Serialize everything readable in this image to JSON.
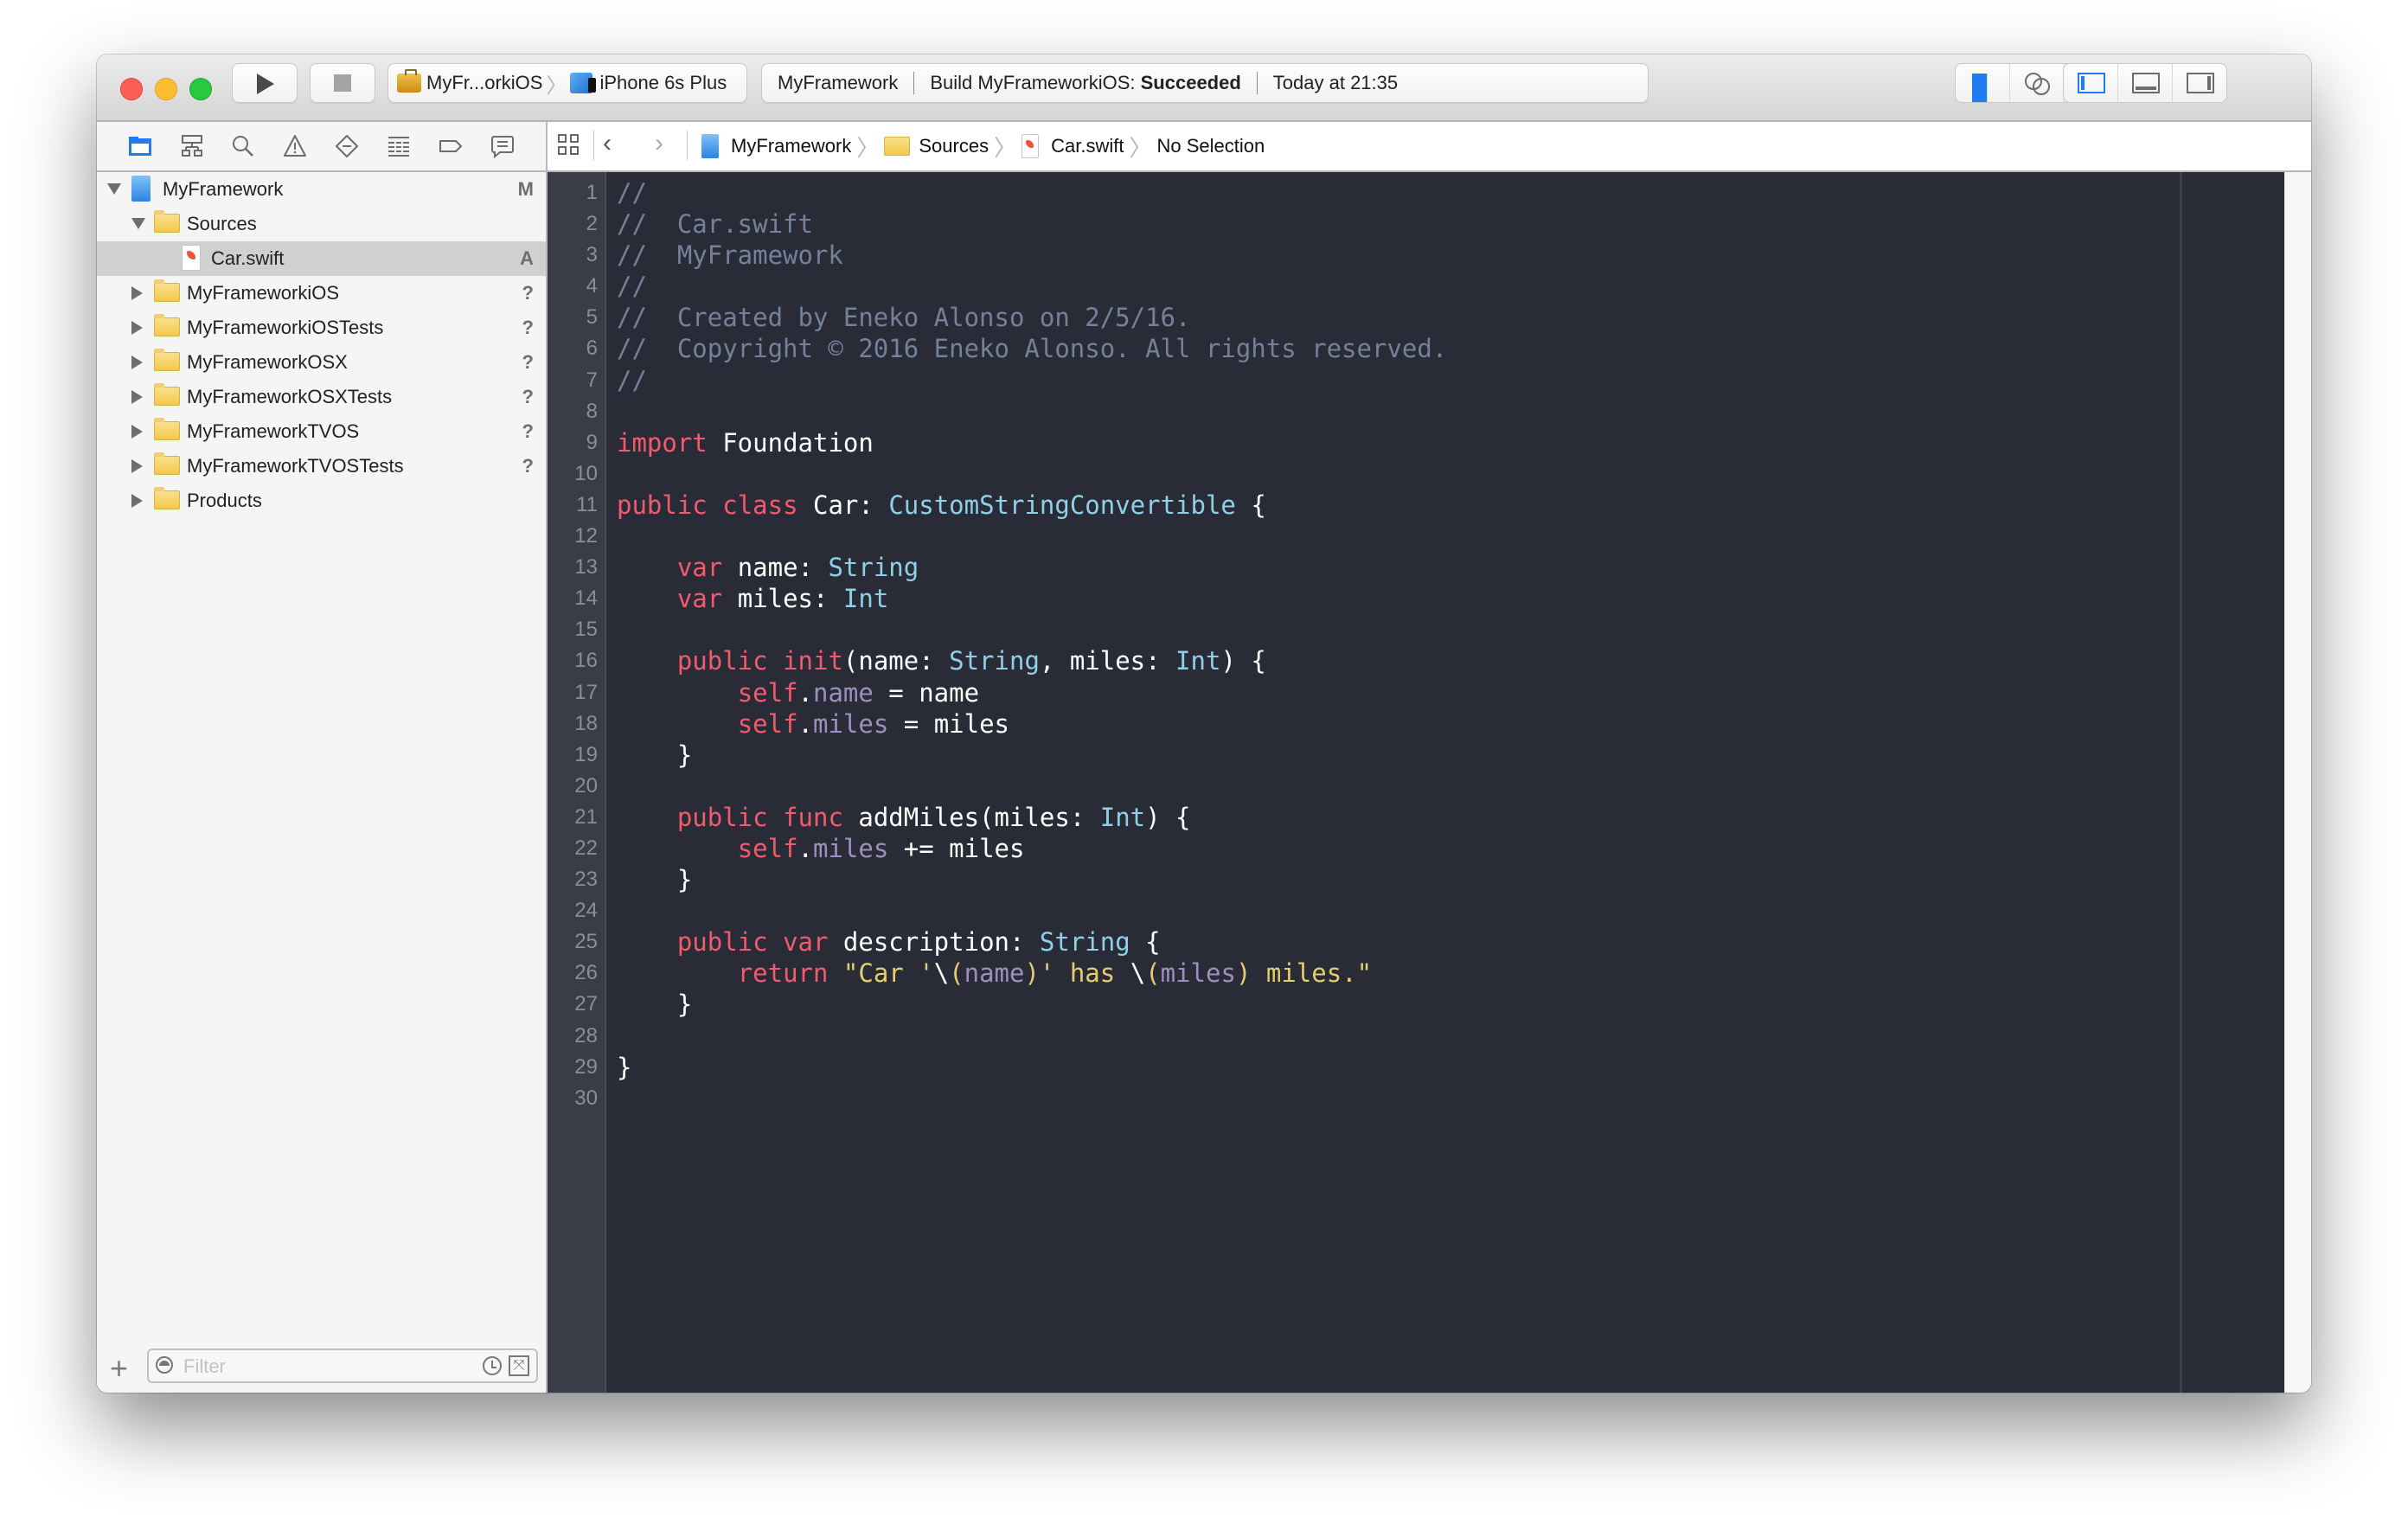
{
  "window": {
    "toolbar": {
      "run_button": "Run",
      "stop_button": "Stop",
      "scheme": {
        "target": "MyFr...orkiOS",
        "device": "iPhone 6s Plus"
      },
      "activity": {
        "project": "MyFramework",
        "status_prefix": "Build MyFrameworkiOS: ",
        "status_result": "Succeeded",
        "time": "Today at 21:35"
      },
      "editor_modes": [
        {
          "name": "standard-editor",
          "active": true
        },
        {
          "name": "assistant-editor",
          "active": false
        },
        {
          "name": "version-editor",
          "active": false
        }
      ],
      "view_toggles": [
        {
          "name": "navigator",
          "active": true
        },
        {
          "name": "debug-area",
          "active": false
        },
        {
          "name": "utilities",
          "active": false
        }
      ],
      "accent_color": "#1f7cf0"
    },
    "navigator": {
      "tabs": [
        "project-navigator",
        "symbol-navigator",
        "find-navigator",
        "issue-navigator",
        "test-navigator",
        "debug-navigator",
        "breakpoint-navigator",
        "report-navigator"
      ],
      "active_tab": "project-navigator",
      "tree": [
        {
          "label": "MyFramework",
          "type": "project",
          "level": 0,
          "expanded": true,
          "badge": "M",
          "selected": false
        },
        {
          "label": "Sources",
          "type": "folder",
          "level": 1,
          "expanded": true,
          "badge": "",
          "selected": false
        },
        {
          "label": "Car.swift",
          "type": "swift",
          "level": 2,
          "expanded": null,
          "badge": "A",
          "selected": true
        },
        {
          "label": "MyFrameworkiOS",
          "type": "folder",
          "level": 1,
          "expanded": false,
          "badge": "?",
          "selected": false
        },
        {
          "label": "MyFrameworkiOSTests",
          "type": "folder",
          "level": 1,
          "expanded": false,
          "badge": "?",
          "selected": false
        },
        {
          "label": "MyFrameworkOSX",
          "type": "folder",
          "level": 1,
          "expanded": false,
          "badge": "?",
          "selected": false
        },
        {
          "label": "MyFrameworkOSXTests",
          "type": "folder",
          "level": 1,
          "expanded": false,
          "badge": "?",
          "selected": false
        },
        {
          "label": "MyFrameworkTVOS",
          "type": "folder",
          "level": 1,
          "expanded": false,
          "badge": "?",
          "selected": false
        },
        {
          "label": "MyFrameworkTVOSTests",
          "type": "folder",
          "level": 1,
          "expanded": false,
          "badge": "?",
          "selected": false
        },
        {
          "label": "Products",
          "type": "folder",
          "level": 1,
          "expanded": false,
          "badge": "",
          "selected": false
        }
      ],
      "filter": {
        "placeholder": "Filter",
        "value": ""
      }
    },
    "jumpbar": {
      "crumbs": [
        {
          "label": "MyFramework",
          "icon": "project-icon"
        },
        {
          "label": "Sources",
          "icon": "folder-icon"
        },
        {
          "label": "Car.swift",
          "icon": "swift-file-icon"
        },
        {
          "label": "No Selection",
          "icon": ""
        }
      ]
    },
    "editor": {
      "colors": {
        "background": "#292c36",
        "comment": "#73819a",
        "keyword": "#f25a6e",
        "type": "#8fd0e8",
        "property": "#9e8fbf",
        "string": "#e7cd72",
        "plain": "#ffffff"
      },
      "lines": [
        [
          [
            "comment",
            "//"
          ]
        ],
        [
          [
            "comment",
            "//  Car.swift"
          ]
        ],
        [
          [
            "comment",
            "//  MyFramework"
          ]
        ],
        [
          [
            "comment",
            "//"
          ]
        ],
        [
          [
            "comment",
            "//  Created by Eneko Alonso on 2/5/16."
          ]
        ],
        [
          [
            "comment",
            "//  Copyright © 2016 Eneko Alonso. All rights reserved."
          ]
        ],
        [
          [
            "comment",
            "//"
          ]
        ],
        [],
        [
          [
            "kw",
            "import"
          ],
          [
            "plain",
            " Foundation"
          ]
        ],
        [],
        [
          [
            "kw",
            "public"
          ],
          [
            "plain",
            " "
          ],
          [
            "kw",
            "class"
          ],
          [
            "plain",
            " Car: "
          ],
          [
            "type",
            "CustomStringConvertible"
          ],
          [
            "plain",
            " {"
          ]
        ],
        [],
        [
          [
            "plain",
            "    "
          ],
          [
            "kw",
            "var"
          ],
          [
            "plain",
            " name: "
          ],
          [
            "type",
            "String"
          ]
        ],
        [
          [
            "plain",
            "    "
          ],
          [
            "kw",
            "var"
          ],
          [
            "plain",
            " miles: "
          ],
          [
            "type",
            "Int"
          ]
        ],
        [],
        [
          [
            "plain",
            "    "
          ],
          [
            "kw",
            "public"
          ],
          [
            "plain",
            " "
          ],
          [
            "kw",
            "init"
          ],
          [
            "plain",
            "(name: "
          ],
          [
            "type",
            "String"
          ],
          [
            "plain",
            ", miles: "
          ],
          [
            "type",
            "Int"
          ],
          [
            "plain",
            ") {"
          ]
        ],
        [
          [
            "plain",
            "        "
          ],
          [
            "kw",
            "self"
          ],
          [
            "plain",
            "."
          ],
          [
            "prop",
            "name"
          ],
          [
            "plain",
            " = name"
          ]
        ],
        [
          [
            "plain",
            "        "
          ],
          [
            "kw",
            "self"
          ],
          [
            "plain",
            "."
          ],
          [
            "prop",
            "miles"
          ],
          [
            "plain",
            " = miles"
          ]
        ],
        [
          [
            "plain",
            "    }"
          ]
        ],
        [],
        [
          [
            "plain",
            "    "
          ],
          [
            "kw",
            "public"
          ],
          [
            "plain",
            " "
          ],
          [
            "kw",
            "func"
          ],
          [
            "plain",
            " addMiles(miles: "
          ],
          [
            "type",
            "Int"
          ],
          [
            "plain",
            ") {"
          ]
        ],
        [
          [
            "plain",
            "        "
          ],
          [
            "kw",
            "self"
          ],
          [
            "plain",
            "."
          ],
          [
            "prop",
            "miles"
          ],
          [
            "plain",
            " += miles"
          ]
        ],
        [
          [
            "plain",
            "    }"
          ]
        ],
        [],
        [
          [
            "plain",
            "    "
          ],
          [
            "kw",
            "public"
          ],
          [
            "plain",
            " "
          ],
          [
            "kw",
            "var"
          ],
          [
            "plain",
            " description: "
          ],
          [
            "type",
            "String"
          ],
          [
            "plain",
            " {"
          ]
        ],
        [
          [
            "plain",
            "        "
          ],
          [
            "kw",
            "return"
          ],
          [
            "plain",
            " "
          ],
          [
            "str",
            "\"Car '"
          ],
          [
            "plain",
            "\\"
          ],
          [
            "str",
            "("
          ],
          [
            "prop",
            "name"
          ],
          [
            "str",
            ")' has "
          ],
          [
            "plain",
            "\\"
          ],
          [
            "str",
            "("
          ],
          [
            "prop",
            "miles"
          ],
          [
            "str",
            ") miles.\""
          ]
        ],
        [
          [
            "plain",
            "    }"
          ]
        ],
        [],
        [
          [
            "plain",
            "}"
          ]
        ],
        []
      ]
    }
  }
}
